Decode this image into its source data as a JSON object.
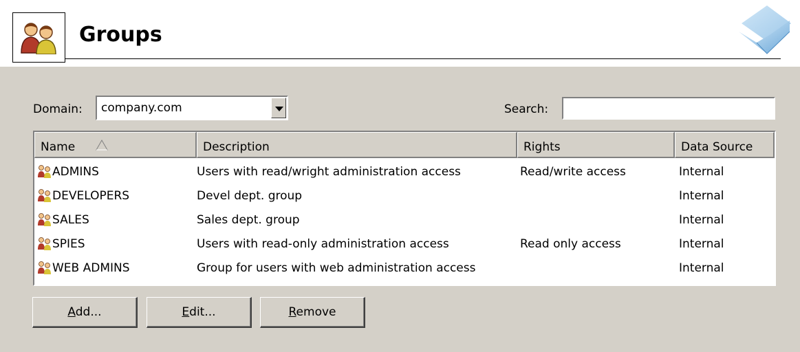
{
  "header": {
    "title": "Groups",
    "icon": "group-users-icon"
  },
  "filters": {
    "domain_label": "Domain:",
    "domain_value": "company.com",
    "search_label": "Search:",
    "search_value": ""
  },
  "table": {
    "columns": [
      "Name",
      "Description",
      "Rights",
      "Data Source"
    ],
    "sorted_column": "Name",
    "sort_direction": "ascending",
    "rows": [
      {
        "name": "ADMINS",
        "description": "Users with read/wright administration access",
        "rights": "Read/write access",
        "source": "Internal"
      },
      {
        "name": "DEVELOPERS",
        "description": "Devel dept. group",
        "rights": "",
        "source": "Internal"
      },
      {
        "name": "SALES",
        "description": "Sales dept. group",
        "rights": "",
        "source": "Internal"
      },
      {
        "name": "SPIES",
        "description": "Users with read-only administration access",
        "rights": "Read only access",
        "source": "Internal"
      },
      {
        "name": "WEB ADMINS",
        "description": "Group for users with web administration access",
        "rights": "",
        "source": "Internal"
      }
    ]
  },
  "buttons": {
    "add_mnemonic": "A",
    "add_rest": "dd...",
    "edit_mnemonic": "E",
    "edit_rest": "dit...",
    "remove_mnemonic": "R",
    "remove_rest": "emove"
  },
  "colors": {
    "panel_bg": "#d4d0c8",
    "header_bg": "#ffffff",
    "logo_blue": "#7fb8e0"
  }
}
